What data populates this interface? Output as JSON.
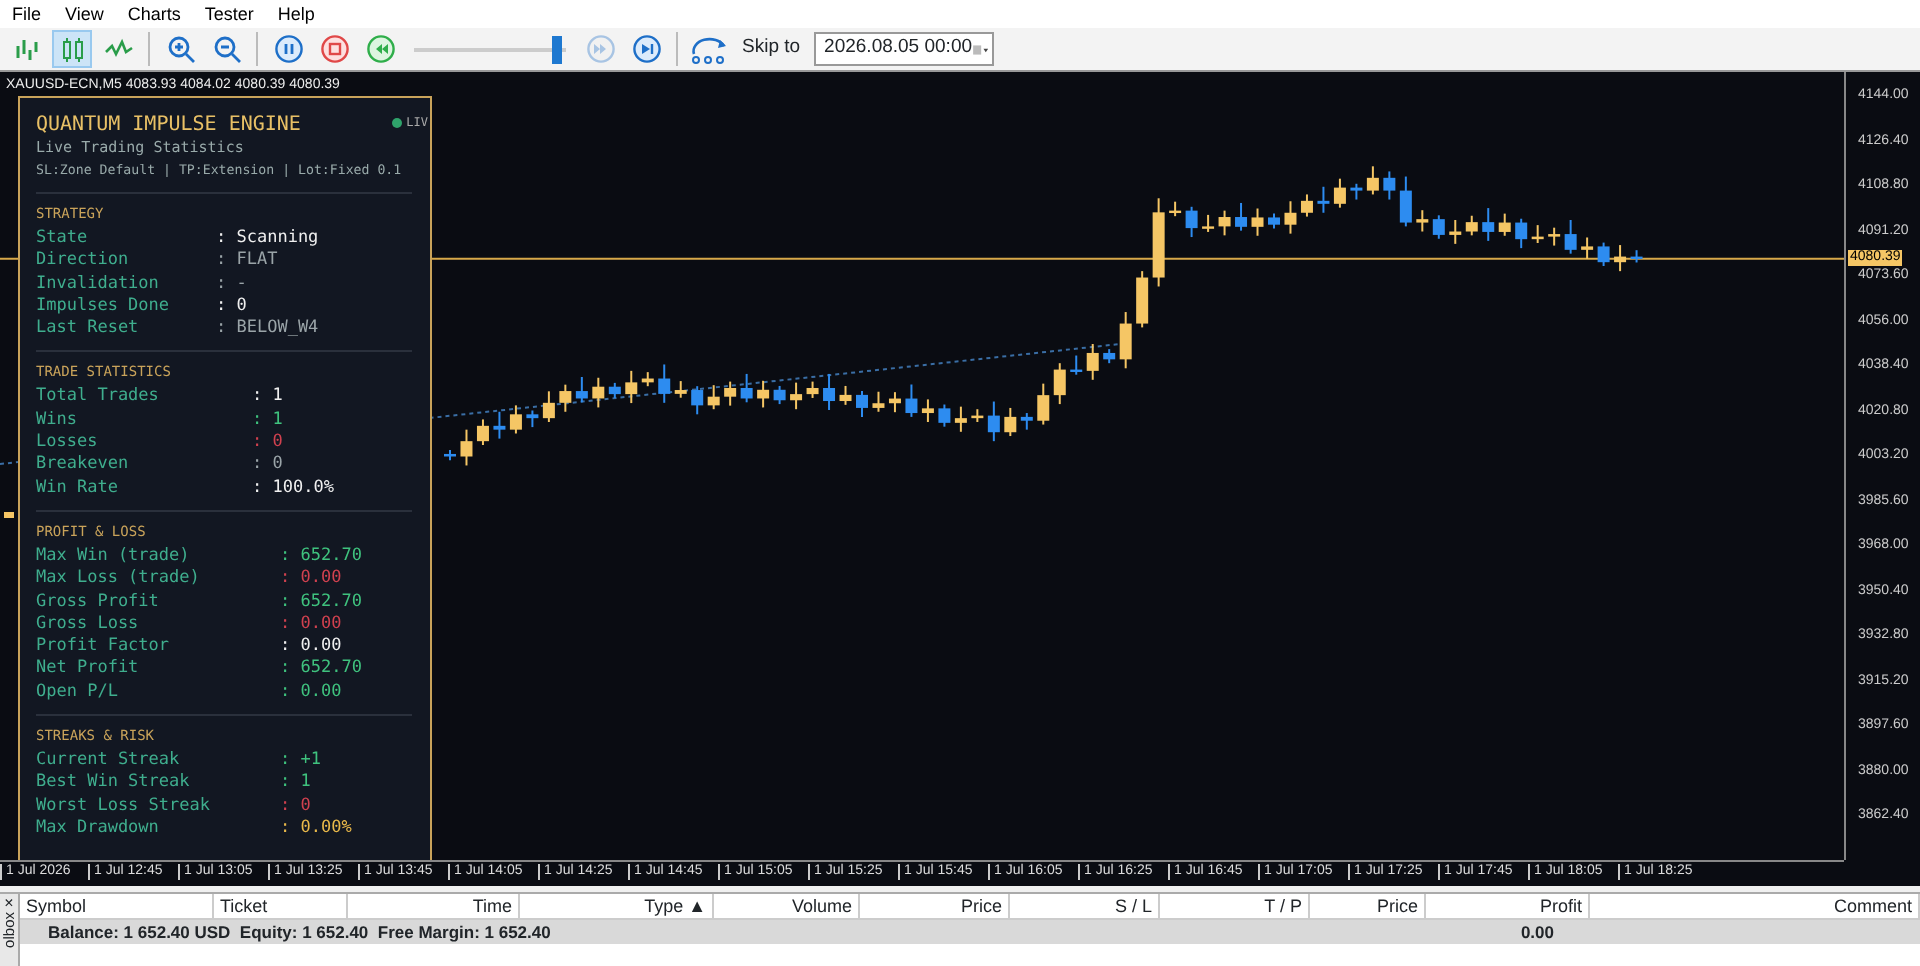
{
  "menu": [
    "File",
    "View",
    "Charts",
    "Tester",
    "Help"
  ],
  "toolbar": {
    "buttons": [
      {
        "kind": "bar-chart",
        "selected": false,
        "disabled": false
      },
      {
        "kind": "candles",
        "selected": true,
        "disabled": false
      },
      {
        "kind": "line-chart",
        "selected": false,
        "disabled": false
      },
      {
        "kind": "sep"
      },
      {
        "kind": "zoom-in",
        "selected": false,
        "disabled": false
      },
      {
        "kind": "zoom-out",
        "selected": false,
        "disabled": false
      },
      {
        "kind": "sep"
      },
      {
        "kind": "pause",
        "selected": false,
        "disabled": false
      },
      {
        "kind": "stop",
        "selected": false,
        "disabled": false
      },
      {
        "kind": "rewind",
        "selected": false,
        "disabled": false
      },
      {
        "kind": "slider",
        "level": 0.97
      },
      {
        "kind": "fast-forward",
        "selected": false,
        "disabled": true
      },
      {
        "kind": "step",
        "selected": false,
        "disabled": false
      },
      {
        "kind": "sep"
      }
    ],
    "skip_label": "Skip to",
    "skip_value": "2026.08.05 00:00"
  },
  "chart": {
    "header": "XAUUSD-ECN,M5  4083.93 4084.02 4080.39 4080.39",
    "current_price": "4080.39",
    "price_axis": [
      "4144.00",
      "4126.40",
      "4108.80",
      "4091.20",
      "4073.60",
      "4056.00",
      "4038.40",
      "4020.80",
      "4003.20",
      "3985.60",
      "3968.00",
      "3950.40",
      "3932.80",
      "3915.20",
      "3897.60",
      "3880.00",
      "3862.40"
    ],
    "time_axis": [
      "1 Jul 2026",
      "1 Jul 12:45",
      "1 Jul 13:05",
      "1 Jul 13:25",
      "1 Jul 13:45",
      "1 Jul 14:05",
      "1 Jul 14:25",
      "1 Jul 14:45",
      "1 Jul 15:05",
      "1 Jul 15:25",
      "1 Jul 15:45",
      "1 Jul 16:05",
      "1 Jul 16:25",
      "1 Jul 16:45",
      "1 Jul 17:05",
      "1 Jul 17:25",
      "1 Jul 17:45",
      "1 Jul 18:05",
      "1 Jul 18:25"
    ]
  },
  "panel": {
    "title": "QUANTUM IMPULSE ENGINE",
    "status": "LIV",
    "subtitle": "Live Trading Statistics",
    "config": "SL:Zone Default | TP:Extension | Lot:Fixed 0.1",
    "sections": [
      {
        "heading": "STRATEGY",
        "rows": [
          {
            "label": "State",
            "value": ": Scanning",
            "color": "#f0f0f0"
          },
          {
            "label": "Direction",
            "value": ": FLAT",
            "color": "#9aa4a8"
          },
          {
            "label": "Invalidation",
            "value": ": -",
            "color": "#9aa4a8"
          },
          {
            "label": "Impulses Done",
            "value": ": 0",
            "color": "#f0f0f0"
          },
          {
            "label": "Last Reset",
            "value": ": BELOW_W4",
            "color": "#9aa4a8"
          }
        ]
      },
      {
        "heading": "TRADE STATISTICS",
        "rows": [
          {
            "label": "Total Trades",
            "value": ": 1",
            "color": "#f0f0f0"
          },
          {
            "label": "Wins",
            "value": ": 1",
            "color": "#3fc27e"
          },
          {
            "label": "Losses",
            "value": ": 0",
            "color": "#d0414f"
          },
          {
            "label": "Breakeven",
            "value": ": 0",
            "color": "#9aa4a8"
          },
          {
            "label": "Win Rate",
            "value": ": 100.0%",
            "color": "#f0f0f0"
          }
        ]
      },
      {
        "heading": "PROFIT & LOSS",
        "rows": [
          {
            "label": "Max Win (trade)",
            "value": ": 652.70",
            "color": "#3fc27e"
          },
          {
            "label": "Max Loss (trade)",
            "value": ": 0.00",
            "color": "#d0414f"
          },
          {
            "label": "Gross Profit",
            "value": ": 652.70",
            "color": "#3fc27e"
          },
          {
            "label": "Gross Loss",
            "value": ": 0.00",
            "color": "#d0414f"
          },
          {
            "label": "Profit Factor",
            "value": ": 0.00",
            "color": "#f0f0f0"
          },
          {
            "label": "Net Profit",
            "value": ": 652.70",
            "color": "#3fc27e"
          },
          {
            "label": "Open P/L",
            "value": ": 0.00",
            "color": "#3fc27e"
          }
        ]
      },
      {
        "heading": "STREAKS & RISK",
        "rows": [
          {
            "label": "Current Streak",
            "value": ": +1",
            "color": "#3fc27e"
          },
          {
            "label": "Best Win Streak",
            "value": ": 1",
            "color": "#3fc27e"
          },
          {
            "label": "Worst Loss Streak",
            "value": ": 0",
            "color": "#d0414f"
          },
          {
            "label": "Max Drawdown",
            "value": ": 0.00%",
            "color": "#e8b84a"
          }
        ]
      }
    ]
  },
  "terminal": {
    "close": "×",
    "side_label": "olbox",
    "columns": [
      "Symbol",
      "Ticket",
      "Time",
      "Type ▲",
      "Volume",
      "Price",
      "S / L",
      "T / P",
      "Price",
      "Profit",
      "Comment"
    ],
    "balance": "Balance: 1 652.40 USD  Equity: 1 652.40  Free Margin: 1 652.40",
    "profit": "0.00"
  }
}
